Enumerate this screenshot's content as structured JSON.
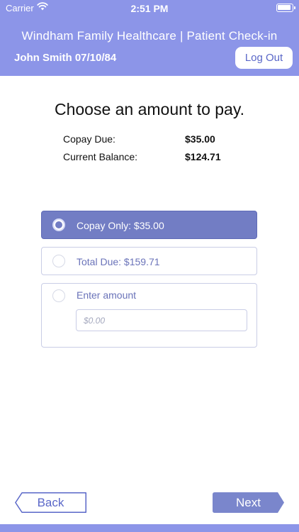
{
  "status_bar": {
    "carrier": "Carrier",
    "time": "2:51 PM",
    "battery_level": 0.95
  },
  "header": {
    "title": "Windham Family Healthcare | Patient Check-in",
    "patient": "John Smith 07/10/84",
    "logout_label": "Log Out"
  },
  "page": {
    "heading": "Choose an amount to pay.",
    "summary": [
      {
        "label": "Copay Due:",
        "value": "$35.00"
      },
      {
        "label": "Current Balance:",
        "value": "$124.71"
      }
    ]
  },
  "options": [
    {
      "label": "Copay Only: $35.00",
      "selected": true
    },
    {
      "label": "Total Due: $159.71",
      "selected": false
    },
    {
      "label": "Enter amount",
      "selected": false
    }
  ],
  "amount_field": {
    "placeholder": "$0.00",
    "value": ""
  },
  "nav": {
    "back_label": "Back",
    "next_label": "Next"
  },
  "colors": {
    "header": "#8c95e8",
    "selected_option": "#727dc4",
    "accent_text": "#5a67c8",
    "next_button": "#7a86cc"
  }
}
